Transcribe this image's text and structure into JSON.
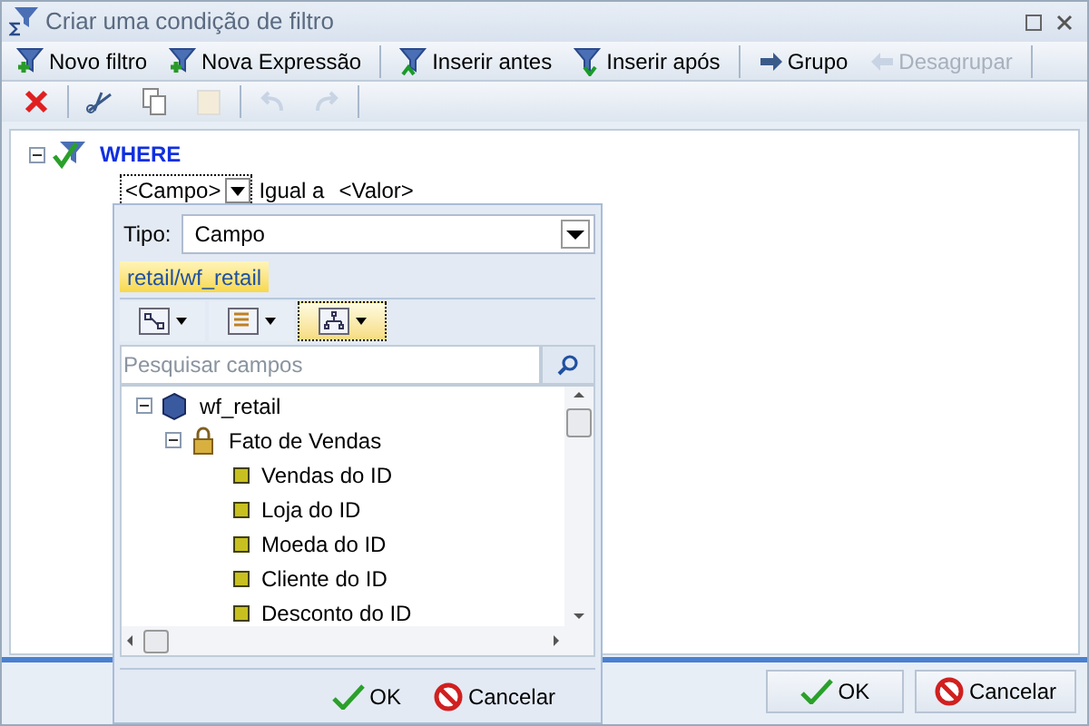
{
  "window": {
    "title": "Criar uma condição de filtro"
  },
  "toolbar": [
    {
      "kind": "new",
      "label": "Novo filtro",
      "disabled": false
    },
    {
      "kind": "new",
      "label": "Nova Expressão",
      "disabled": false
    },
    {
      "kind": "before",
      "label": "Inserir antes",
      "disabled": false
    },
    {
      "kind": "after",
      "label": "Inserir após",
      "disabled": false
    },
    {
      "kind": "group",
      "label": "Grupo",
      "disabled": false
    },
    {
      "kind": "ungroup",
      "label": "Desagrupar",
      "disabled": true
    }
  ],
  "edit_toolbar": [
    {
      "kind": "delete",
      "disabled": false
    },
    {
      "kind": "cut",
      "disabled": false
    },
    {
      "kind": "copy",
      "disabled": false
    },
    {
      "kind": "paste",
      "disabled": true
    },
    {
      "kind": "undo",
      "disabled": true
    },
    {
      "kind": "redo",
      "disabled": true
    }
  ],
  "condition": {
    "label": "WHERE",
    "expanded": true,
    "field": "<Campo>",
    "operator": "Igual a",
    "value": "<Valor>"
  },
  "picker": {
    "type_label": "Tipo:",
    "type_value": "Campo",
    "tab": "retail/wf_retail",
    "views": [
      {
        "kind": "diagram",
        "selected": false
      },
      {
        "kind": "list",
        "selected": false
      },
      {
        "kind": "tree",
        "selected": true
      }
    ],
    "search": {
      "placeholder": "Pesquisar campos"
    },
    "tree": [
      {
        "label": "wf_retail",
        "kind": "database",
        "expanded": true,
        "children": [
          {
            "label": "Fato de Vendas",
            "kind": "folder",
            "expanded": true,
            "children": [
              {
                "label": "Vendas do ID",
                "kind": "field"
              },
              {
                "label": "Loja do ID",
                "kind": "field"
              },
              {
                "label": "Moeda do ID",
                "kind": "field"
              },
              {
                "label": "Cliente do ID",
                "kind": "field"
              },
              {
                "label": "Desconto do ID",
                "kind": "field"
              }
            ]
          }
        ]
      }
    ],
    "buttons": [
      {
        "kind": "ok",
        "label": "OK"
      },
      {
        "kind": "cancel",
        "label": "Cancelar"
      }
    ]
  },
  "buttons": [
    {
      "kind": "ok",
      "label": "OK"
    },
    {
      "kind": "cancel",
      "label": "Cancelar"
    }
  ]
}
